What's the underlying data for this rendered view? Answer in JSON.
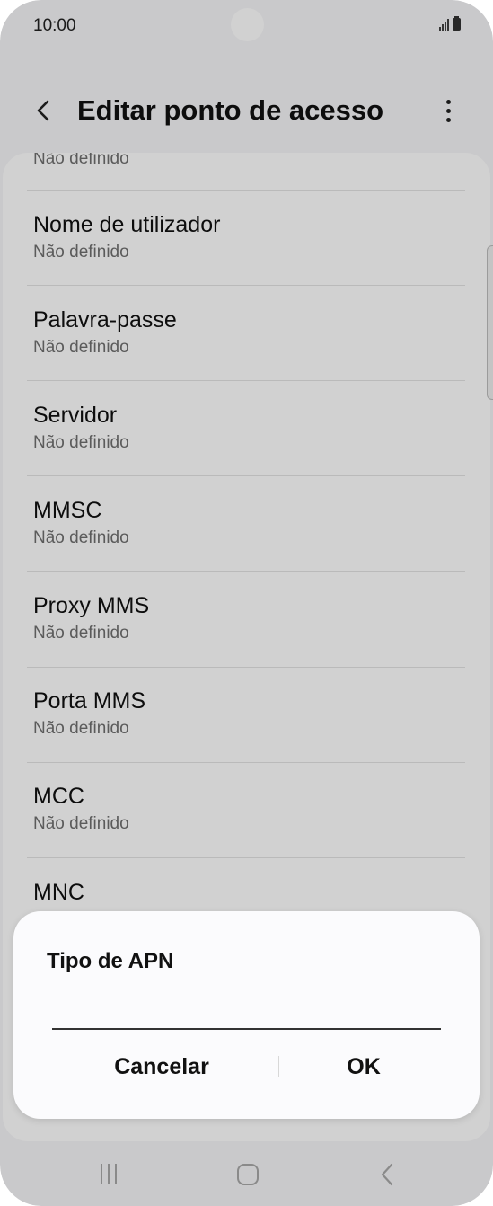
{
  "status_bar": {
    "time": "10:00"
  },
  "header": {
    "title": "Editar ponto de acesso",
    "back_icon": "chevron-left-icon",
    "more_icon": "more-vertical-icon"
  },
  "list": {
    "partial_top_value": "Não definido",
    "items": [
      {
        "title": "Nome de utilizador",
        "value": "Não definido"
      },
      {
        "title": "Palavra-passe",
        "value": "Não definido"
      },
      {
        "title": "Servidor",
        "value": "Não definido"
      },
      {
        "title": "MMSC",
        "value": "Não definido"
      },
      {
        "title": "Proxy MMS",
        "value": "Não definido"
      },
      {
        "title": "Porta MMS",
        "value": "Não definido"
      },
      {
        "title": "MCC",
        "value": "Não definido"
      },
      {
        "title": "MNC",
        "value": ""
      }
    ]
  },
  "dialog": {
    "title": "Tipo de APN",
    "input_value": "",
    "cancel_label": "Cancelar",
    "ok_label": "OK"
  },
  "nav_bar": {
    "recents_icon": "recents-icon",
    "home_icon": "home-icon",
    "back_icon": "nav-back-icon"
  }
}
